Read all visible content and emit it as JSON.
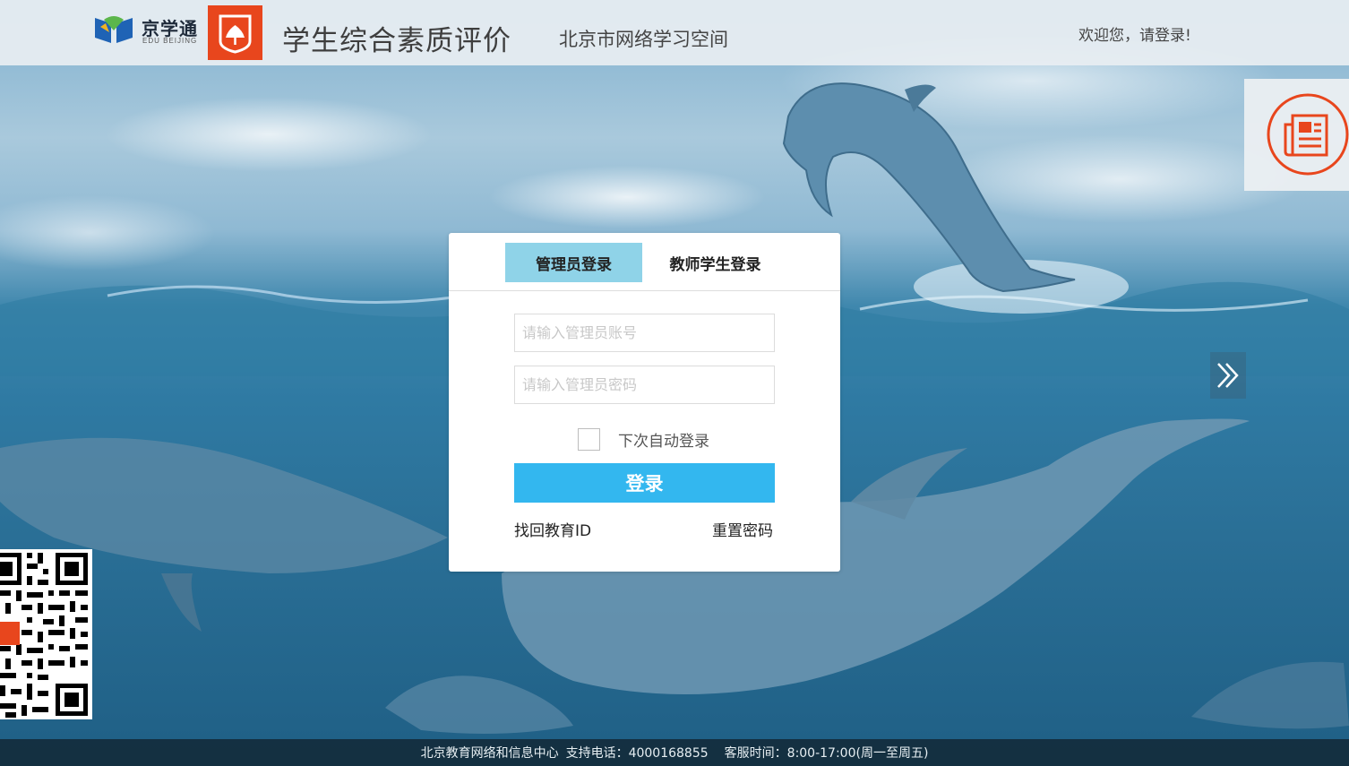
{
  "header": {
    "brand_name": "京学通",
    "brand_sub": "EDU BEIJING",
    "title": "学生综合素质评价",
    "subtitle": "北京市网络学习空间",
    "welcome": "欢迎您，请登录!"
  },
  "login": {
    "tabs": [
      {
        "label": "管理员登录",
        "active": true
      },
      {
        "label": "教师学生登录",
        "active": false
      }
    ],
    "account_placeholder": "请输入管理员账号",
    "account_value": "",
    "password_placeholder": "请输入管理员密码",
    "password_value": "",
    "remember_label": "下次自动登录",
    "remember_checked": false,
    "submit_label": "登录",
    "find_id_link": "找回教育ID",
    "reset_password_link": "重置密码"
  },
  "footer": {
    "org": "北京教育网络和信息中心",
    "phone": "支持电话：4000168855",
    "hours": "客服时间：8:00-17:00(周一至周五)"
  },
  "icons": {
    "news": "news-icon",
    "next": "chevron-double-right-icon",
    "qr": "qr-code-icon"
  },
  "colors": {
    "accent": "#33b7ef",
    "tab_active": "#8fd3e8",
    "brand_red": "#e8461d",
    "footer_bg": "#142d3c"
  }
}
